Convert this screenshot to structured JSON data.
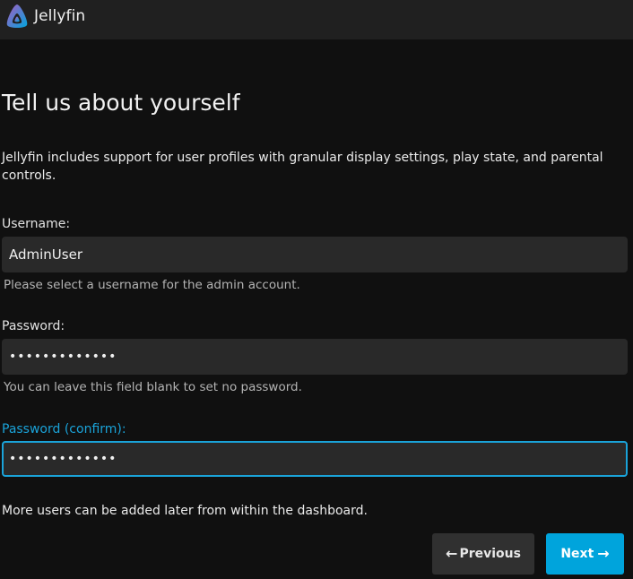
{
  "header": {
    "app_name": "Jellyfin",
    "logo_icon": "jellyfin-logo-icon",
    "colors": {
      "logo_start": "#aa5cc3",
      "logo_end": "#00a4dc"
    }
  },
  "page": {
    "title": "Tell us about yourself",
    "intro": "Jellyfin includes support for user profiles with granular display settings, play state, and parental controls."
  },
  "form": {
    "username": {
      "label": "Username:",
      "value": "AdminUser",
      "help": "Please select a username for the admin account."
    },
    "password": {
      "label": "Password:",
      "value": "•••••••••••••",
      "help": "You can leave this field blank to set no password."
    },
    "password_confirm": {
      "label": "Password (confirm):",
      "value": "•••••••••••••"
    }
  },
  "footer": {
    "note": "More users can be added later from within the dashboard.",
    "previous_label": "Previous",
    "next_label": "Next",
    "previous_icon": "arrow-left-icon",
    "next_icon": "arrow-right-icon"
  },
  "colors": {
    "accent": "#00a4dc",
    "focus_label": "#1aa3d9",
    "background": "#101010",
    "header": "#202020",
    "field": "#292929"
  }
}
